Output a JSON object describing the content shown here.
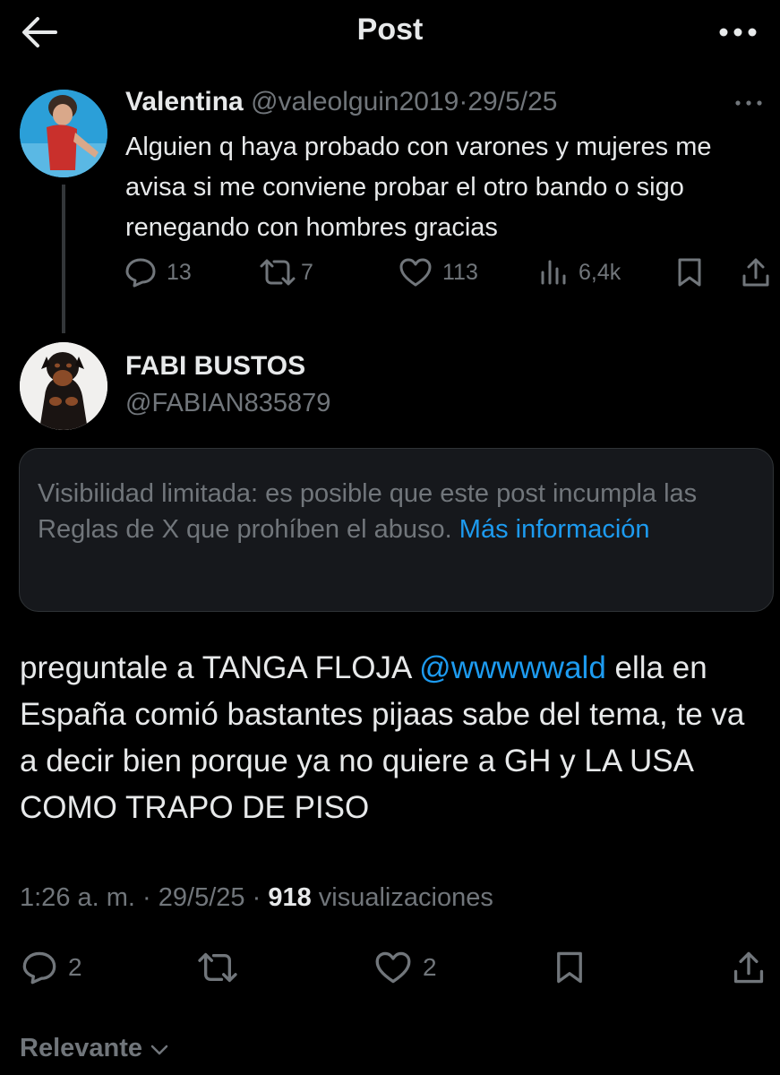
{
  "header": {
    "title": "Post"
  },
  "parent_post": {
    "author_name": "Valentina",
    "handle": "@valeolguin2019",
    "separator": "·",
    "date": "29/5/25",
    "text": "Alguien q haya probado con varones y mujeres me avisa si me conviene probar el otro bando o sigo renegando con hombres gracias",
    "replies": "13",
    "reposts": "7",
    "likes": "113",
    "views": "6,4k"
  },
  "reply_post": {
    "author_name": "FABI BUSTOS",
    "handle": "@FABIAN835879",
    "notice_text": "Visibilidad limitada: es posible que este post incumpla las Reglas de X que prohíben el abuso.",
    "notice_link": "Más información",
    "text_before_mention": "preguntale a TANGA FLOJA ",
    "mention": "@wwwwwald",
    "text_after_mention": " ella en España comió bastantes pijaas sabe del tema, te va a decir bien porque ya no quiere a GH y LA USA COMO TRAPO DE PISO",
    "time": "1:26 a. m.",
    "separator": "·",
    "date": "29/5/25",
    "views_count": "918",
    "views_label": "visualizaciones",
    "replies": "2",
    "likes": "2"
  },
  "sort": {
    "label": "Relevante"
  },
  "colors": {
    "background": "#000000",
    "text": "#e7e9ea",
    "muted": "#71767b",
    "link": "#1d9bf0",
    "notice_bg": "#16181c"
  },
  "icons": [
    "back-arrow-icon",
    "more-icon",
    "reply-icon",
    "repost-icon",
    "like-icon",
    "views-icon",
    "bookmark-icon",
    "share-icon",
    "chevron-down-icon"
  ]
}
